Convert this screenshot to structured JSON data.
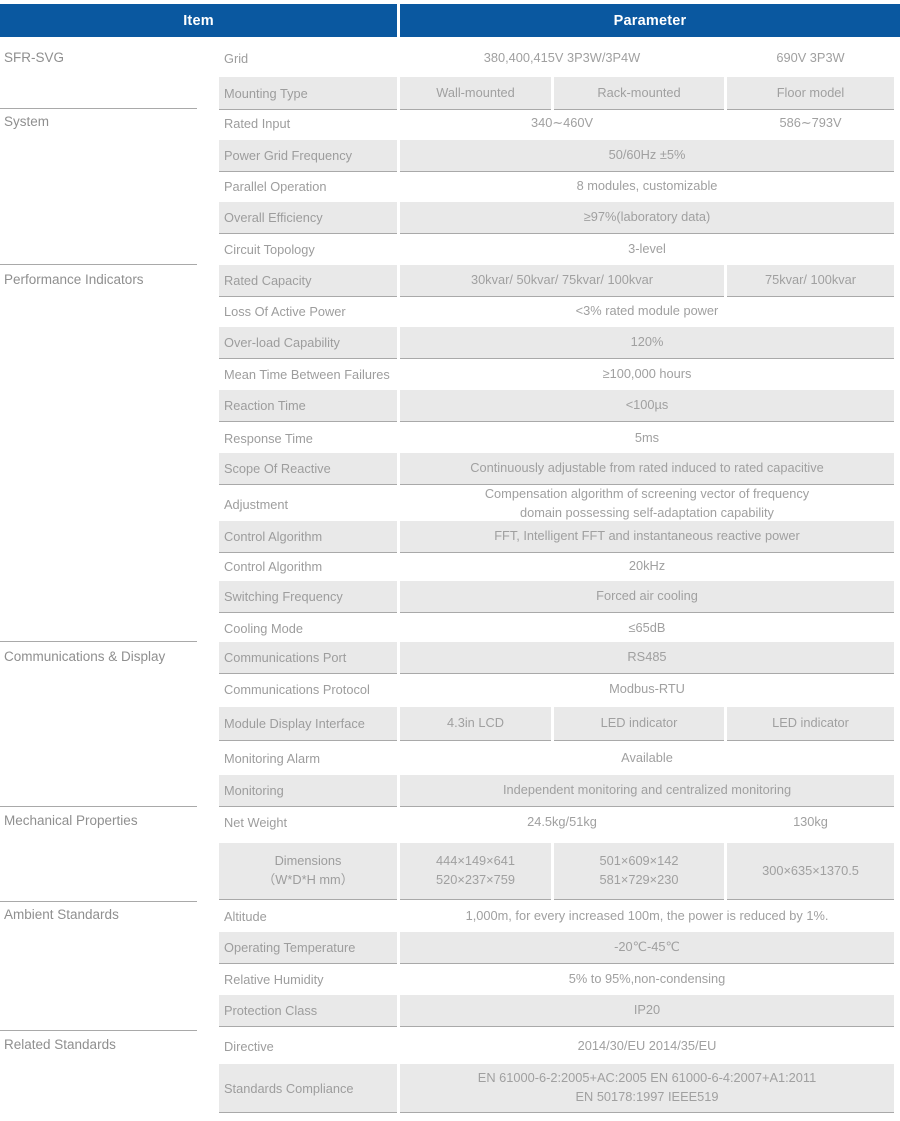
{
  "header": {
    "item": "Item",
    "parameter": "Parameter"
  },
  "colors": {
    "header_blue": "#0a58a0",
    "band_grey": "#e9e9e9",
    "text_grey": "#9a9a9a",
    "rule_grey": "#a9a9a9"
  },
  "categories": [
    {
      "label": "SFR-SVG"
    },
    {
      "label": "System"
    },
    {
      "label": "Performance Indicators"
    },
    {
      "label": "Communications & Display"
    },
    {
      "label": "Mechanical Properties"
    },
    {
      "label": "Ambient Standards"
    },
    {
      "label": "Related  Standards"
    }
  ],
  "rows": [
    {
      "item": "Grid",
      "values": [
        "380,400,415V 3P3W/3P4W",
        "690V 3P3W"
      ],
      "split": "two"
    },
    {
      "item": "Mounting Type",
      "values": [
        "Wall-mounted",
        "Rack-mounted",
        "Floor model"
      ],
      "split": "three"
    },
    {
      "item": "Rated Input",
      "values": [
        "340∼460V",
        "586∼793V"
      ],
      "split": "two"
    },
    {
      "item": "Power Grid Frequency",
      "values": [
        "50/60Hz ±5%"
      ],
      "split": "one"
    },
    {
      "item": "Parallel Operation",
      "values": [
        "8 modules, customizable"
      ],
      "split": "one"
    },
    {
      "item": "Overall Efficiency",
      "values": [
        "≥97%(laboratory data)"
      ],
      "split": "one"
    },
    {
      "item": "Circuit Topology",
      "values": [
        "3-level"
      ],
      "split": "one"
    },
    {
      "item": "Rated Capacity",
      "values": [
        "30kvar/ 50kvar/ 75kvar/ 100kvar",
        "75kvar/ 100kvar"
      ],
      "split": "two"
    },
    {
      "item": "Loss Of Active Power",
      "values": [
        "<3% rated module power"
      ],
      "split": "one"
    },
    {
      "item": "Over-load Capability",
      "values": [
        "120%"
      ],
      "split": "one"
    },
    {
      "item": "Mean Time Between Failures",
      "values": [
        "≥100,000 hours"
      ],
      "split": "one"
    },
    {
      "item": "Reaction Time",
      "values": [
        "<100µs"
      ],
      "split": "one"
    },
    {
      "item": "Response Time",
      "values": [
        "5ms"
      ],
      "split": "one"
    },
    {
      "item": "Scope Of Reactive",
      "values": [
        "Continuously adjustable from rated induced to rated capacitive"
      ],
      "split": "one"
    },
    {
      "item": "Adjustment",
      "values": [
        "Compensation algorithm of screening vector of frequency\ndomain possessing self-adaptation capability"
      ],
      "split": "one"
    },
    {
      "item": "Control Algorithm",
      "values": [
        "FFT, Intelligent FFT and instantaneous reactive power"
      ],
      "split": "one"
    },
    {
      "item": "Control Algorithm",
      "values": [
        "20kHz"
      ],
      "split": "one"
    },
    {
      "item": "Switching Frequency",
      "values": [
        "Forced air cooling"
      ],
      "split": "one"
    },
    {
      "item": "Cooling Mode",
      "values": [
        "≤65dB"
      ],
      "split": "one"
    },
    {
      "item": "Communications Port",
      "values": [
        "RS485"
      ],
      "split": "one"
    },
    {
      "item": "Communications Protocol",
      "values": [
        "Modbus-RTU"
      ],
      "split": "one"
    },
    {
      "item": "Module Display Interface",
      "values": [
        "4.3in LCD",
        "LED indicator",
        "LED indicator"
      ],
      "split": "three"
    },
    {
      "item": "Monitoring Alarm",
      "values": [
        "Available"
      ],
      "split": "one"
    },
    {
      "item": "Monitoring",
      "values": [
        "Independent monitoring and centralized monitoring"
      ],
      "split": "one"
    },
    {
      "item": "Net Weight",
      "values": [
        "24.5kg/51kg",
        "130kg"
      ],
      "split": "two"
    },
    {
      "item": "Dimensions\n（W*D*H mm）",
      "values": [
        "444×149×641\n520×237×759",
        "501×609×142\n581×729×230",
        "300×635×1370.5"
      ],
      "split": "three"
    },
    {
      "item": "Altitude",
      "values": [
        "1,000m, for every increased 100m, the power is reduced by 1%."
      ],
      "split": "one"
    },
    {
      "item": "Operating Temperature",
      "values": [
        "-20℃-45℃"
      ],
      "split": "one"
    },
    {
      "item": "Relative Humidity",
      "values": [
        "5% to 95%,non-condensing"
      ],
      "split": "one"
    },
    {
      "item": "Protection Class",
      "values": [
        "IP20"
      ],
      "split": "one"
    },
    {
      "item": "Directive",
      "values": [
        "2014/30/EU  2014/35/EU"
      ],
      "split": "one"
    },
    {
      "item": "Standards Compliance",
      "values": [
        "EN 61000-6-2:2005+AC:2005  EN 61000-6-4:2007+A1:2011\nEN 50178:1997  IEEE519"
      ],
      "split": "one"
    }
  ]
}
